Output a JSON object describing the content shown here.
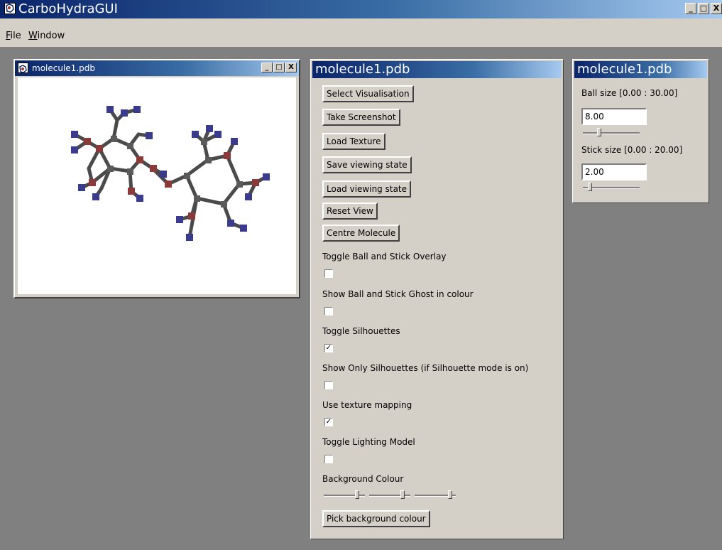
{
  "app": {
    "title": "CarboHydraGUI",
    "window_buttons": [
      "_",
      "□",
      "X"
    ]
  },
  "menu": {
    "items": [
      {
        "label_first": "F",
        "label_rest": "ile"
      },
      {
        "label_first": "W",
        "label_rest": "indow"
      }
    ]
  },
  "viewer": {
    "title": "molecule1.pdb",
    "buttons": [
      "_",
      "□",
      "X"
    ]
  },
  "panel": {
    "title": "molecule1.pdb",
    "buttons": [
      "Select Visualisation",
      "Take Screenshot",
      "Load Texture",
      "Save viewing state",
      "Load viewing state",
      "Reset View",
      "Centre Molecule"
    ],
    "toggles": [
      {
        "label": "Toggle Ball and Stick Overlay",
        "checked": false
      },
      {
        "label": "Show Ball and Stick Ghost in colour",
        "checked": false
      },
      {
        "label": "Toggle Silhouettes",
        "checked": true
      },
      {
        "label": "Show Only Silhouettes (if Silhouette mode is on)",
        "checked": false
      },
      {
        "label": "Use texture mapping",
        "checked": true
      },
      {
        "label": "Toggle Lighting Model",
        "checked": false
      }
    ],
    "background_label": "Background Colour",
    "background_sliders": [
      0.85,
      0.85,
      0.9
    ],
    "pick_background_label": "Pick background colour"
  },
  "size_panel": {
    "title": "molecule1.pdb",
    "ball_label": "Ball size [0.00 : 30.00]",
    "ball_value": "8.00",
    "ball_slider": 0.27,
    "stick_label": "Stick size [0.00 : 20.00]",
    "stick_value": "2.00",
    "stick_slider": 0.1
  },
  "colors": {
    "atom_red": "#8b3a3a",
    "atom_blue": "#3b3b8e",
    "bond": "#4a4a4a"
  }
}
